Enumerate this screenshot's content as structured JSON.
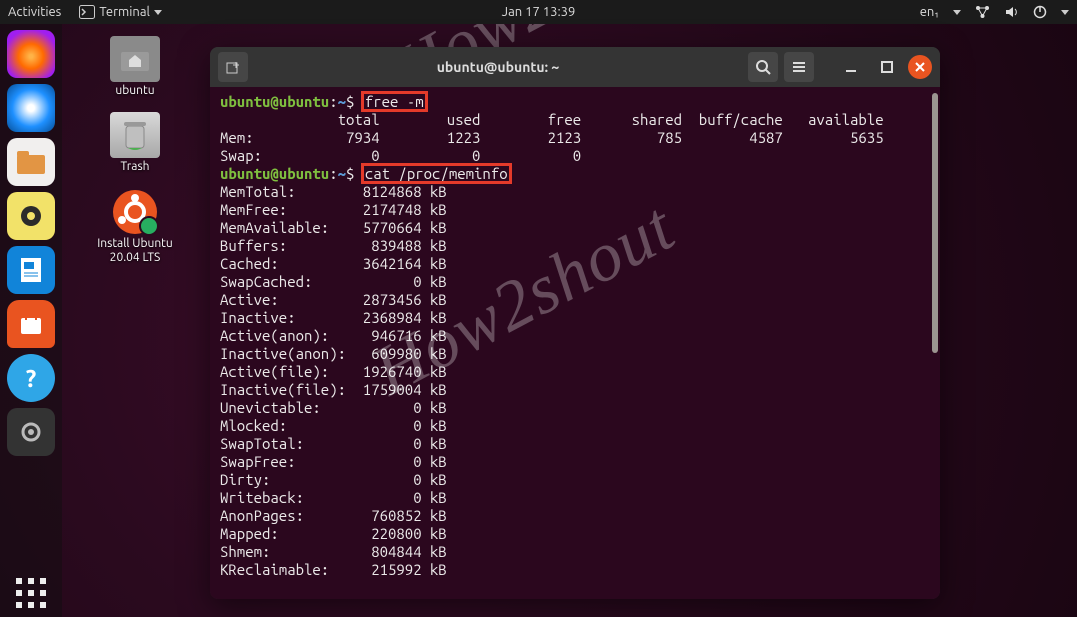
{
  "topbar": {
    "activities": "Activities",
    "terminal_menu": "Terminal",
    "clock": "Jan 17  13:39",
    "lang": "en₁"
  },
  "desktop": {
    "home": "ubuntu",
    "trash": "Trash",
    "installer": "Install Ubuntu\n20.04 LTS"
  },
  "terminal": {
    "title": "ubuntu@ubuntu: ~",
    "prompt_user": "ubuntu@ubuntu",
    "prompt_sep": ":",
    "prompt_path": "~",
    "prompt_char": "$",
    "cmd1": "free -m",
    "free_header": "              total        used        free      shared  buff/cache   available",
    "free_mem": "Mem:           7934        1223        2123         785        4587        5635",
    "free_swap": "Swap:             0           0           0",
    "cmd2": "cat /proc/meminfo",
    "meminfo": [
      "MemTotal:        8124868 kB",
      "MemFree:         2174748 kB",
      "MemAvailable:    5770664 kB",
      "Buffers:          839488 kB",
      "Cached:          3642164 kB",
      "SwapCached:            0 kB",
      "Active:          2873456 kB",
      "Inactive:        2368984 kB",
      "Active(anon):     946716 kB",
      "Inactive(anon):   609980 kB",
      "Active(file):    1926740 kB",
      "Inactive(file):  1759004 kB",
      "Unevictable:           0 kB",
      "Mlocked:               0 kB",
      "SwapTotal:             0 kB",
      "SwapFree:              0 kB",
      "Dirty:                 0 kB",
      "Writeback:             0 kB",
      "AnonPages:        760852 kB",
      "Mapped:           220800 kB",
      "Shmem:            804844 kB",
      "KReclaimable:     215992 kB"
    ]
  },
  "watermark": "How2shout"
}
